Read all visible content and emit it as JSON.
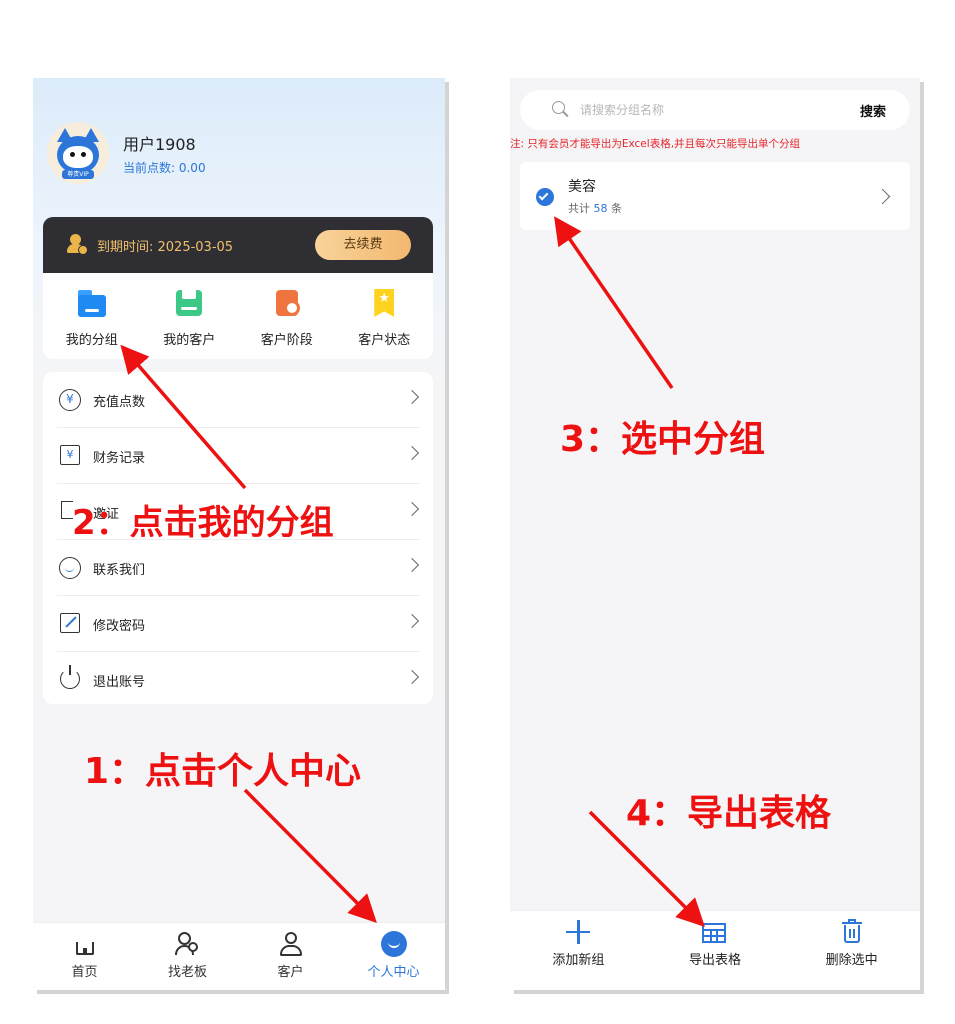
{
  "left_screen": {
    "profile": {
      "user_name": "用户1908",
      "points": "当前点数: 0.00",
      "avatar_badge": "尊贵VIP"
    },
    "vip": {
      "expire_text": "到期时间: 2025-03-05",
      "renew_label": "去续费"
    },
    "quick_actions": [
      {
        "label": "我的分组",
        "icon": "folder-icon"
      },
      {
        "label": "我的客户",
        "icon": "save-icon"
      },
      {
        "label": "客户阶段",
        "icon": "clock-icon"
      },
      {
        "label": "客户状态",
        "icon": "star-flag-icon"
      }
    ],
    "menu_items": [
      {
        "label": "充值点数",
        "icon": "yen-circle-icon"
      },
      {
        "label": "财务记录",
        "icon": "yen-box-icon"
      },
      {
        "label": "邀证",
        "icon": "bracket-icon"
      },
      {
        "label": "联系我们",
        "icon": "support-icon"
      },
      {
        "label": "修改密码",
        "icon": "edit-icon"
      },
      {
        "label": "退出账号",
        "icon": "power-icon"
      }
    ],
    "tabs": [
      {
        "label": "首页",
        "icon": "home-icon"
      },
      {
        "label": "找老板",
        "icon": "find-boss-icon"
      },
      {
        "label": "客户",
        "icon": "user-icon"
      },
      {
        "label": "个人中心",
        "icon": "profile-smile-icon",
        "active": true
      }
    ]
  },
  "right_screen": {
    "search": {
      "placeholder": "请搜索分组名称",
      "button_label": "搜索"
    },
    "notice": "注: 只有会员才能导出为Excel表格,并且每次只能导出单个分组",
    "group": {
      "name": "美容",
      "count_prefix": "共计",
      "count": "58",
      "count_suffix": "条"
    },
    "actions": [
      {
        "label": "添加新组",
        "icon": "plus-icon"
      },
      {
        "label": "导出表格",
        "icon": "table-icon"
      },
      {
        "label": "删除选中",
        "icon": "trash-icon"
      }
    ]
  },
  "annotations": {
    "step1": "1：点击个人中心",
    "step2": "2：点击我的分组",
    "step3": "3：选中分组",
    "step4": "4：导出表格"
  },
  "colors": {
    "accent": "#2b76d8",
    "annotation": "#ee1111",
    "vip_bar": "#2e2e33",
    "vip_text": "#f0c06b"
  }
}
